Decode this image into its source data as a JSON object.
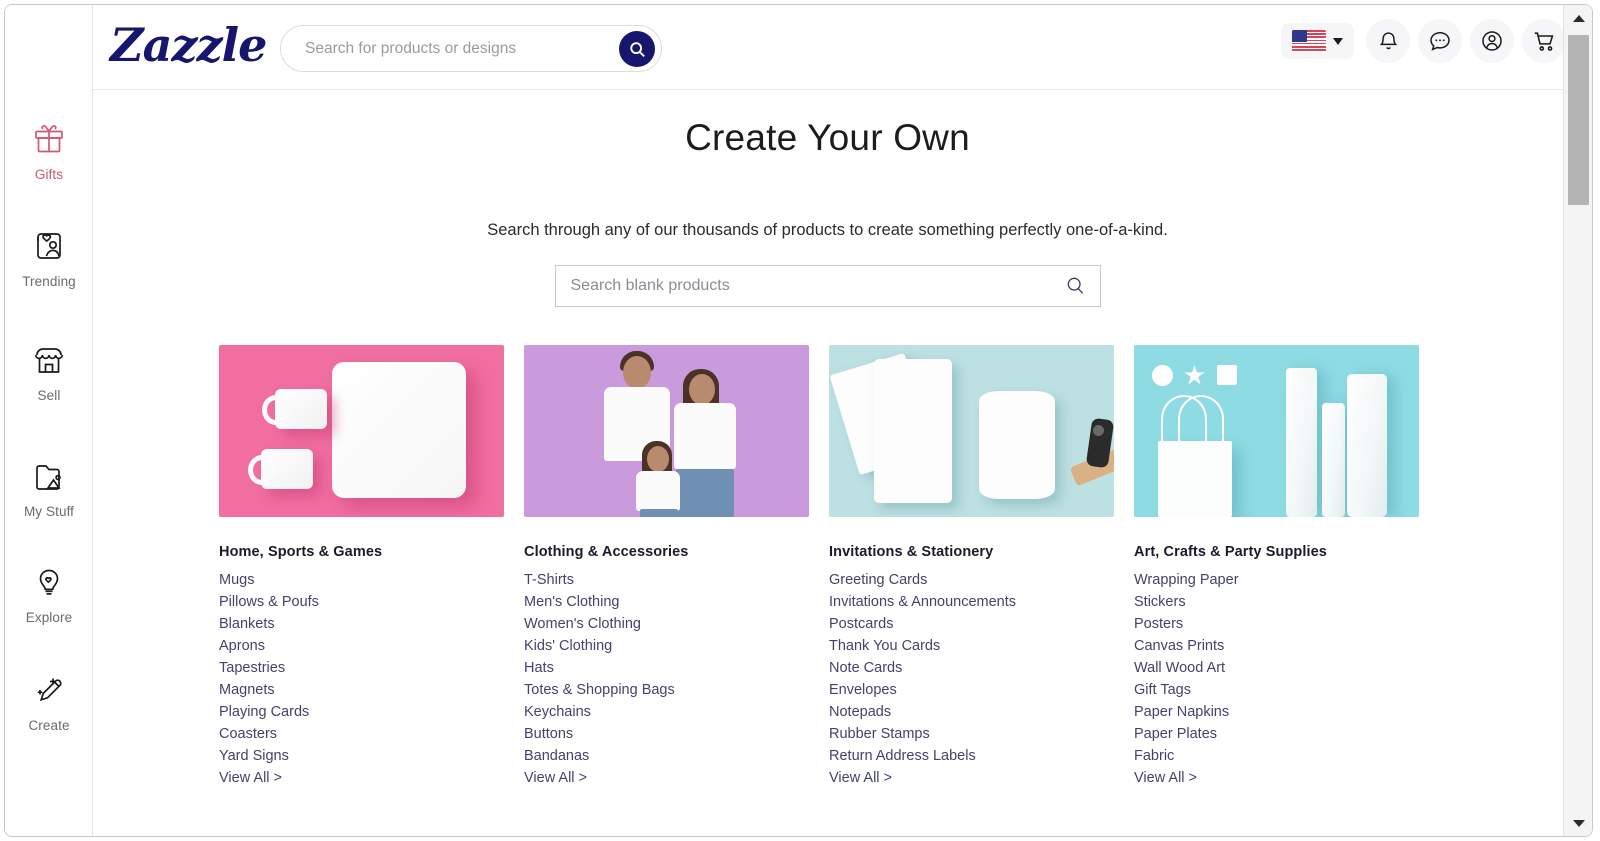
{
  "brand": {
    "name": "Zazzle",
    "color": "#16166e"
  },
  "header": {
    "hamburger_label": "menu-icon",
    "search": {
      "placeholder": "Search for products or designs",
      "value": "",
      "button_label": "search-icon"
    },
    "locale": {
      "flag": "us-flag",
      "caret": "chevron-down-icon"
    },
    "actions": [
      {
        "name": "notifications",
        "icon": "bell-icon"
      },
      {
        "name": "messages",
        "icon": "chat-bubble-icon"
      },
      {
        "name": "account",
        "icon": "user-circle-icon"
      },
      {
        "name": "cart",
        "icon": "shopping-cart-icon"
      }
    ]
  },
  "sidebar": {
    "items": [
      {
        "label": "Gifts",
        "icon": "gift-icon",
        "active": true
      },
      {
        "label": "Trending",
        "icon": "trending-person-heart-icon",
        "active": false
      },
      {
        "label": "Sell",
        "icon": "storefront-icon",
        "active": false
      },
      {
        "label": "My Stuff",
        "icon": "folder-image-icon",
        "active": false
      },
      {
        "label": "Explore",
        "icon": "lightbulb-heart-icon",
        "active": false
      },
      {
        "label": "Create",
        "icon": "pencil-sparkle-icon",
        "active": false
      }
    ]
  },
  "main": {
    "title": "Create Your Own",
    "subtitle": "Search through any of our thousands of products to create something perfectly one-of-a-kind.",
    "blank_search": {
      "placeholder": "Search blank products",
      "value": "",
      "icon": "search-icon"
    },
    "view_all_label": "View All >",
    "categories": [
      {
        "title": "Home, Sports & Games",
        "thumb_alt": "two white mugs and a white pillow on a pink background",
        "links": [
          "Mugs",
          "Pillows & Poufs",
          "Blankets",
          "Aprons",
          "Tapestries",
          "Magnets",
          "Playing Cards",
          "Coasters",
          "Yard Signs"
        ]
      },
      {
        "title": "Clothing & Accessories",
        "thumb_alt": "family of three wearing plain white t-shirts on a lilac background",
        "links": [
          "T-Shirts",
          "Men's Clothing",
          "Women's Clothing",
          "Kids' Clothing",
          "Hats",
          "Totes & Shopping Bags",
          "Keychains",
          "Buttons",
          "Bandanas"
        ]
      },
      {
        "title": "Invitations & Stationery",
        "thumb_alt": "blank white cards and a rubber stamp on a mint background",
        "links": [
          "Greeting Cards",
          "Invitations & Announcements",
          "Postcards",
          "Thank You Cards",
          "Note Cards",
          "Envelopes",
          "Notepads",
          "Rubber Stamps",
          "Return Address Labels"
        ]
      },
      {
        "title": "Art, Crafts & Party Supplies",
        "thumb_alt": "white gift bag, paper rolls and stickers on an aqua background",
        "links": [
          "Wrapping Paper",
          "Stickers",
          "Posters",
          "Canvas Prints",
          "Wall Wood Art",
          "Gift Tags",
          "Paper Napkins",
          "Paper Plates",
          "Fabric"
        ]
      }
    ]
  },
  "scrollbar": {
    "up": "scroll-up-arrow",
    "down": "scroll-down-arrow",
    "position_percent": 4
  }
}
